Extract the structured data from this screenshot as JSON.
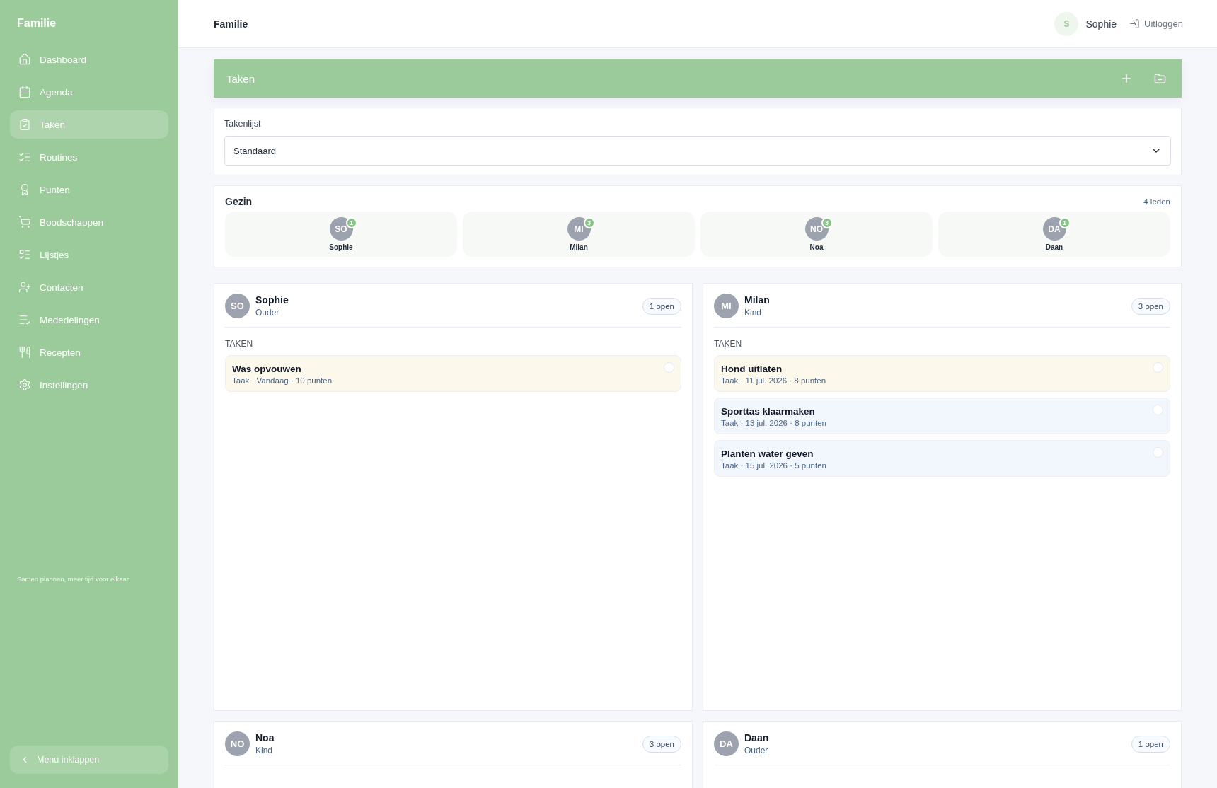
{
  "sidebar": {
    "brand": "Familie",
    "items": [
      {
        "label": "Dashboard",
        "selected": false
      },
      {
        "label": "Agenda",
        "selected": false
      },
      {
        "label": "Taken",
        "selected": true
      },
      {
        "label": "Routines",
        "selected": false
      },
      {
        "label": "Punten",
        "selected": false
      },
      {
        "label": "Boodschappen",
        "selected": false
      },
      {
        "label": "Lijstjes",
        "selected": false
      },
      {
        "label": "Contacten",
        "selected": false
      },
      {
        "label": "Mededelingen",
        "selected": false
      },
      {
        "label": "Recepten",
        "selected": false
      },
      {
        "label": "Instellingen",
        "selected": false
      }
    ],
    "tagline": "Samen plannen, meer tijd voor elkaar.",
    "collapse_button": "Menu inklappen"
  },
  "header": {
    "title": "Familie",
    "user": {
      "initial": "S",
      "name": "Sophie"
    },
    "logout": "Uitloggen"
  },
  "banner": {
    "title": "Taken"
  },
  "task_list": {
    "label": "Takenlijst",
    "value": "Standaard"
  },
  "family": {
    "title": "Gezin",
    "count": "4 leden",
    "members": [
      {
        "initials": "SO",
        "name": "Sophie",
        "badge": "1"
      },
      {
        "initials": "MI",
        "name": "Milan",
        "badge": "3"
      },
      {
        "initials": "NO",
        "name": "Noa",
        "badge": "3"
      },
      {
        "initials": "DA",
        "name": "Daan",
        "badge": "1"
      }
    ]
  },
  "member_cards": [
    {
      "initials": "SO",
      "name": "Sophie",
      "role": "Ouder",
      "open": "1 open",
      "section": "TAKEN",
      "tasks": [
        {
          "title": "Was opvouwen",
          "meta": "Taak · Vandaag · 10 punten",
          "kind": "due",
          "checked": false
        }
      ]
    },
    {
      "initials": "MI",
      "name": "Milan",
      "role": "Kind",
      "open": "3 open",
      "section": "TAKEN",
      "tasks": [
        {
          "title": "Hond uitlaten",
          "meta": "Taak · 11 jul. 2026 · 8 punten",
          "kind": "due",
          "checked": false
        },
        {
          "title": "Sporttas klaarmaken",
          "meta": "Taak · 13 jul. 2026 · 8 punten",
          "kind": "planned",
          "checked": false
        },
        {
          "title": "Planten water geven",
          "meta": "Taak · 15 jul. 2026 · 5 punten",
          "kind": "planned",
          "checked": false
        }
      ]
    },
    {
      "initials": "NO",
      "name": "Noa",
      "role": "Kind",
      "open": "3 open"
    },
    {
      "initials": "DA",
      "name": "Daan",
      "role": "Ouder",
      "open": "1 open"
    }
  ]
}
